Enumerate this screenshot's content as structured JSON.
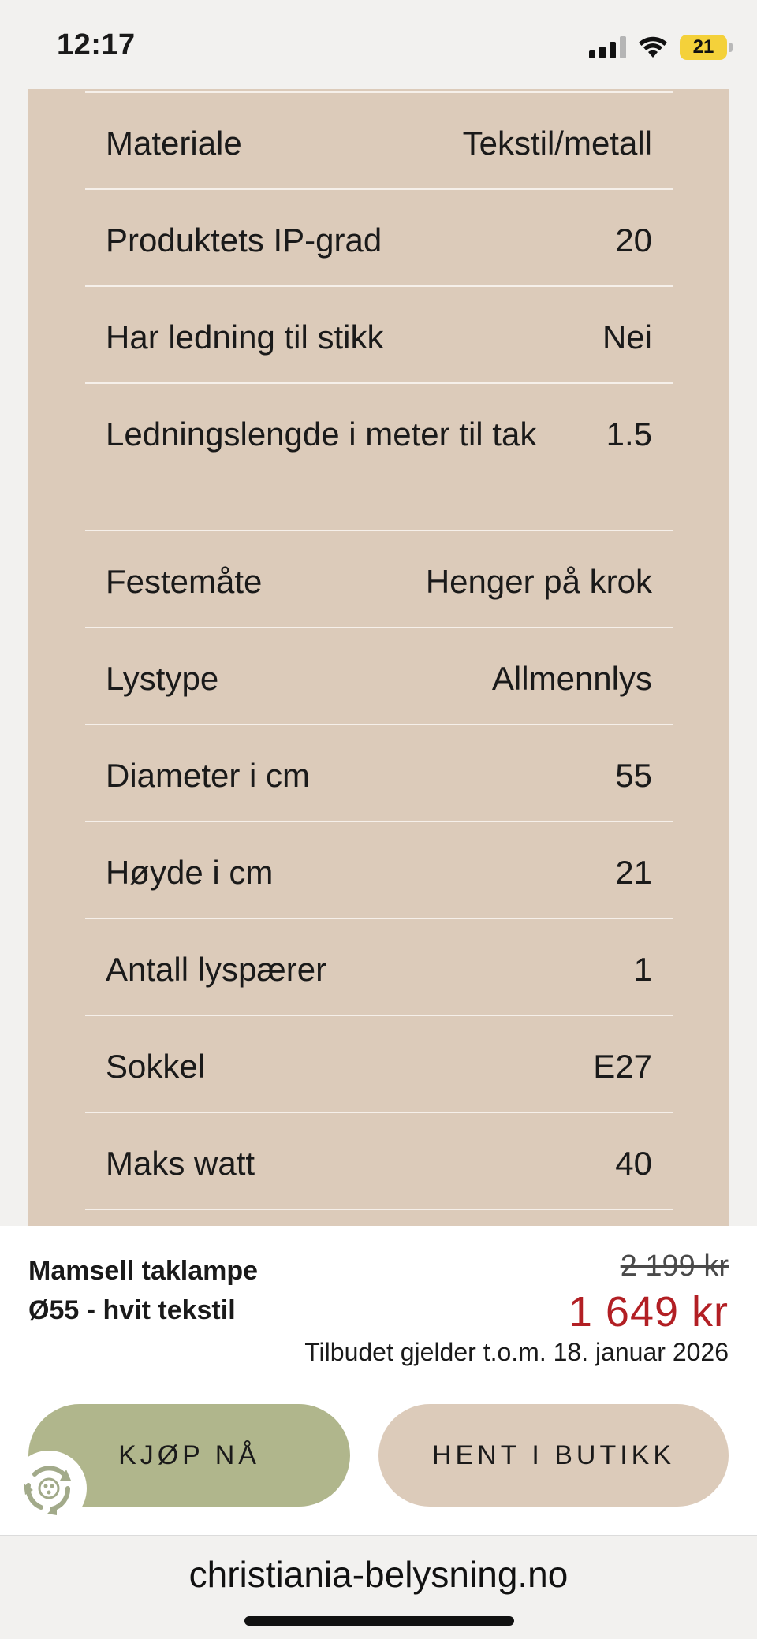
{
  "status_bar": {
    "time": "12:17",
    "battery_level": "21",
    "battery_color": "#f4d13a"
  },
  "specs": [
    {
      "label": "Materiale",
      "value": "Tekstil/metall"
    },
    {
      "label": "Produktets IP-grad",
      "value": "20"
    },
    {
      "label": "Har ledning til stikk",
      "value": "Nei"
    },
    {
      "label": "Ledningslengde i meter til tak",
      "value": "1.5"
    },
    {
      "label": "Festemåte",
      "value": "Henger på krok"
    },
    {
      "label": "Lystype",
      "value": "Allmennlys"
    },
    {
      "label": "Diameter i cm",
      "value": "55"
    },
    {
      "label": "Høyde i cm",
      "value": "21"
    },
    {
      "label": "Antall lyspærer",
      "value": "1"
    },
    {
      "label": "Sokkel",
      "value": "E27"
    },
    {
      "label": "Maks watt",
      "value": "40"
    }
  ],
  "product": {
    "name": "Mamsell taklampe Ø55 - hvit tekstil",
    "old_price": "2 199 kr",
    "price": "1 649 kr",
    "offer_note": "Tilbudet gjelder t.o.m. 18. januar 2026"
  },
  "actions": {
    "buy_label": "KJØP NÅ",
    "pickup_label": "HENT I BUTIKK"
  },
  "browser": {
    "url": "christiania-belysning.no"
  },
  "colors": {
    "panel": "#dccbba",
    "buy_button": "#b0b68c",
    "sale_price": "#b21f24"
  }
}
